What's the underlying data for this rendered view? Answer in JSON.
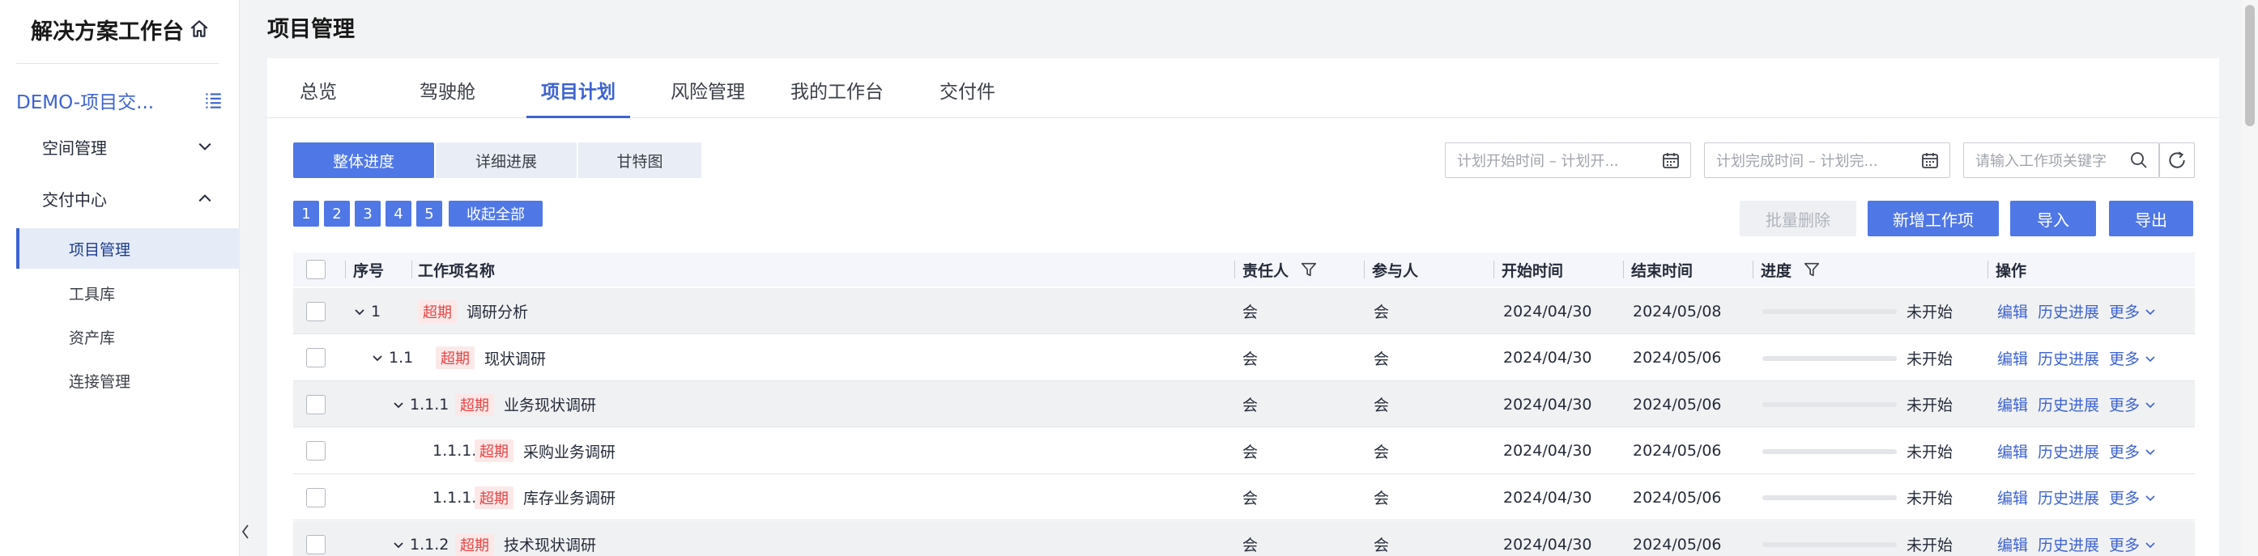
{
  "sidebar": {
    "title": "解决方案工作台",
    "project": "DEMO-项目交...",
    "groups": [
      {
        "label": "空间管理",
        "state": "collapsed"
      },
      {
        "label": "交付中心",
        "state": "expanded"
      }
    ],
    "items": [
      "项目管理",
      "工具库",
      "资产库",
      "连接管理"
    ]
  },
  "page": {
    "title": "项目管理"
  },
  "tabs": [
    "总览",
    "驾驶舱",
    "项目计划",
    "风险管理",
    "我的工作台",
    "交付件"
  ],
  "view_modes": [
    "整体进度",
    "详细进展",
    "甘特图"
  ],
  "filters": {
    "plan_start": "计划开始时间 – 计划开...",
    "plan_end": "计划完成时间 – 计划完...",
    "keyword": "请输入工作项关键字"
  },
  "levels": [
    "1",
    "2",
    "3",
    "4",
    "5"
  ],
  "collapse_all": "收起全部",
  "actions": {
    "batch_delete": "批量删除",
    "add": "新增工作项",
    "import": "导入",
    "export": "导出"
  },
  "table": {
    "headers": {
      "index": "序号",
      "name": "工作项名称",
      "owner": "责任人",
      "participants": "参与人",
      "start": "开始时间",
      "end": "结束时间",
      "progress": "进度",
      "ops": "操作"
    },
    "rows": [
      {
        "index": "1",
        "tag": "超期",
        "name": "调研分析",
        "owner": "会",
        "participants": "会",
        "start": "2024/04/30",
        "end": "2024/05/08",
        "progress": 0,
        "status": "未开始"
      },
      {
        "index": "1.1",
        "tag": "超期",
        "name": "现状调研",
        "owner": "会",
        "participants": "会",
        "start": "2024/04/30",
        "end": "2024/05/06",
        "progress": 0,
        "status": "未开始"
      },
      {
        "index": "1.1.1",
        "tag": "超期",
        "name": "业务现状调研",
        "owner": "会",
        "participants": "会",
        "start": "2024/04/30",
        "end": "2024/05/06",
        "progress": 0,
        "status": "未开始"
      },
      {
        "index": "1.1.1.1",
        "tag": "超期",
        "name": "采购业务调研",
        "owner": "会",
        "participants": "会",
        "start": "2024/04/30",
        "end": "2024/05/06",
        "progress": 0,
        "status": "未开始"
      },
      {
        "index": "1.1.1.2",
        "tag": "超期",
        "name": "库存业务调研",
        "owner": "会",
        "participants": "会",
        "start": "2024/04/30",
        "end": "2024/05/06",
        "progress": 0,
        "status": "未开始"
      },
      {
        "index": "1.1.2",
        "tag": "超期",
        "name": "技术现状调研",
        "owner": "会",
        "participants": "会",
        "start": "2024/04/30",
        "end": "2024/05/06",
        "progress": 0,
        "status": "未开始"
      }
    ],
    "row_ops": {
      "edit": "编辑",
      "history": "历史进展",
      "more": "更多"
    }
  },
  "colors": {
    "accent": "#4f77e6",
    "link": "#3d63d2",
    "overdue_bg": "#fde8e8",
    "overdue_text": "#e54545"
  }
}
